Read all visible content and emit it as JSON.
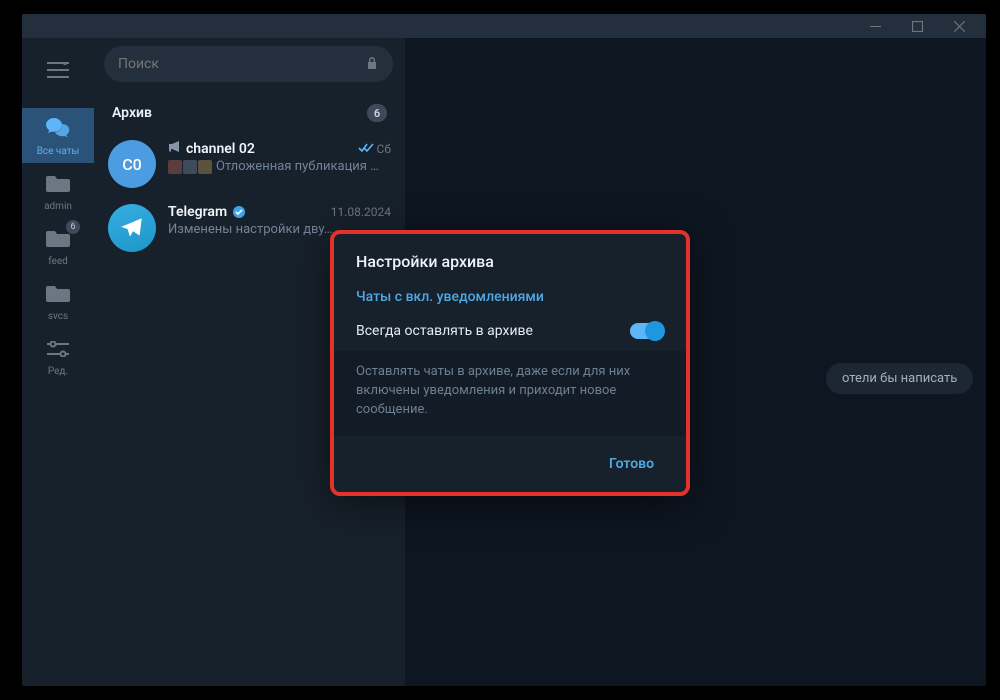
{
  "search": {
    "placeholder": "Поиск"
  },
  "rail": {
    "items": [
      {
        "label": "Все чаты"
      },
      {
        "label": "admin"
      },
      {
        "label": "feed",
        "badge": "6"
      },
      {
        "label": "svcs"
      },
      {
        "label": "Ред."
      }
    ]
  },
  "archive": {
    "title": "Архив",
    "count": "6"
  },
  "chats": [
    {
      "name": "channel 02",
      "time": "Сб",
      "preview": "Отложенная публикация …",
      "avatar_text": "C0"
    },
    {
      "name": "Telegram",
      "time": "11.08.2024",
      "preview": "Изменены настройки дву…"
    }
  ],
  "hint": "отели бы написать",
  "dialog": {
    "title": "Настройки архива",
    "section": "Чаты с вкл. уведомлениями",
    "row_label": "Всегда оставлять в архиве",
    "description": "Оставлять чаты в архиве, даже если для них включены уведомления и приходит новое сообщение.",
    "done": "Готово"
  }
}
